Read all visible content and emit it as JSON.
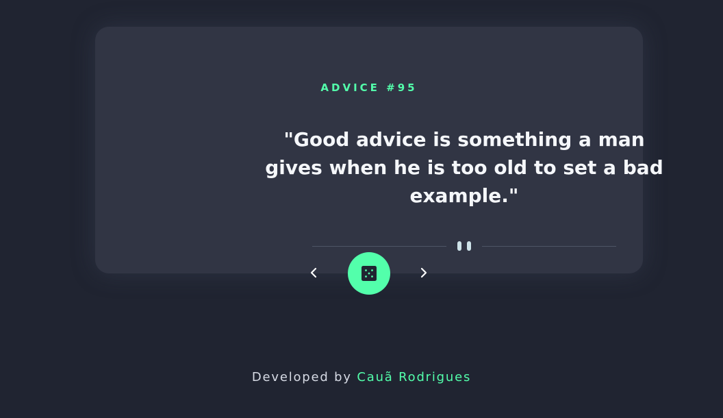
{
  "card": {
    "advice_label": "ADVICE #95",
    "quote": "\"Good advice is something a man gives when he is too old to set a bad example.\""
  },
  "controls": {
    "prev_icon": "chevron-left-icon",
    "dice_icon": "dice-icon",
    "next_icon": "chevron-right-icon"
  },
  "footer": {
    "prefix": "Developed by",
    "author": "Cauã Rodrigues"
  },
  "colors": {
    "background": "#202431",
    "card": "#313544",
    "accent": "#53ffab",
    "quote_text": "#f5f7fa"
  }
}
